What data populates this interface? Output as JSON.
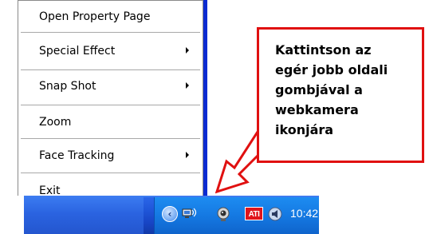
{
  "context_menu": {
    "items": [
      {
        "label": "Open Property Page",
        "has_submenu": false
      },
      {
        "label": "Special Effect",
        "has_submenu": true
      },
      {
        "label": "Snap Shot",
        "has_submenu": true
      },
      {
        "label": "Zoom",
        "has_submenu": false
      },
      {
        "label": "Face Tracking",
        "has_submenu": true
      },
      {
        "label": "Exit",
        "has_submenu": false
      }
    ]
  },
  "callout": {
    "lines": [
      "Kattintson az",
      "egér jobb oldali",
      "gombjával a",
      "webkamera",
      "ikonjára"
    ],
    "border_color": "#e01010"
  },
  "taskbar": {
    "clock": "10:42",
    "show_hidden_icon": "chevron-left",
    "ati_label": "ATI",
    "tray_icons": [
      "network-icon",
      "webcam-icon",
      "ati-icon",
      "volume-icon"
    ]
  },
  "colors": {
    "taskbar_blue": "#1f56d9",
    "notification_area": "#1579e2",
    "menu_border": "#8a8a8a",
    "ati_red": "#e0141b"
  }
}
